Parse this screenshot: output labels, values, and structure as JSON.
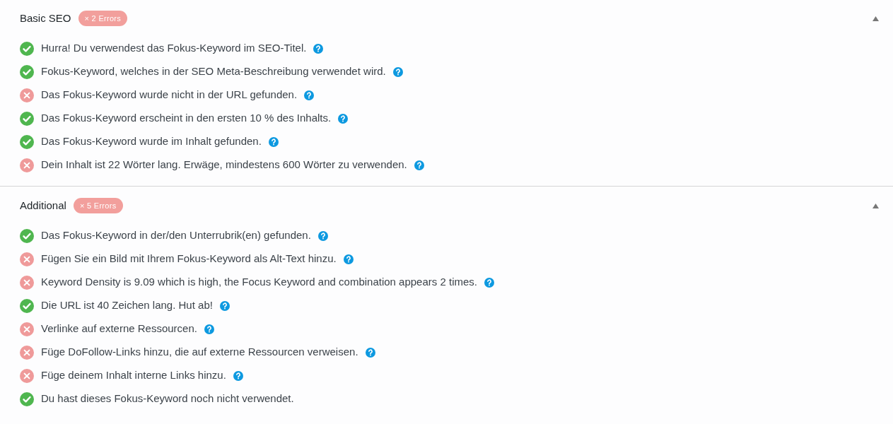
{
  "sections": [
    {
      "title": "Basic SEO",
      "badge": "× 2 Errors",
      "expanded": true,
      "items": [
        {
          "passed": true,
          "text": "Hurra! Du verwendest das Fokus-Keyword im SEO-Titel.",
          "help": true
        },
        {
          "passed": true,
          "text": "Fokus-Keyword, welches in der SEO Meta-Beschreibung verwendet wird.",
          "help": true
        },
        {
          "passed": false,
          "text": "Das Fokus-Keyword wurde nicht in der URL gefunden.",
          "help": true
        },
        {
          "passed": true,
          "text": "Das Fokus-Keyword erscheint in den ersten 10 % des Inhalts.",
          "help": true
        },
        {
          "passed": true,
          "text": "Das Fokus-Keyword wurde im Inhalt gefunden.",
          "help": true
        },
        {
          "passed": false,
          "text": "Dein Inhalt ist 22 Wörter lang. Erwäge, mindestens 600 Wörter zu verwenden.",
          "help": true
        }
      ]
    },
    {
      "title": "Additional",
      "badge": "× 5 Errors",
      "expanded": true,
      "items": [
        {
          "passed": true,
          "text": "Das Fokus-Keyword in der/den Unterrubrik(en) gefunden.",
          "help": true
        },
        {
          "passed": false,
          "text": "Fügen Sie ein Bild mit Ihrem Fokus-Keyword als Alt-Text hinzu.",
          "help": true
        },
        {
          "passed": false,
          "text": "Keyword Density is 9.09 which is high, the Focus Keyword and combination appears 2 times.",
          "help": true
        },
        {
          "passed": true,
          "text": "Die URL ist 40 Zeichen lang. Hut ab!",
          "help": true
        },
        {
          "passed": false,
          "text": "Verlinke auf externe Ressourcen.",
          "help": true
        },
        {
          "passed": false,
          "text": "Füge DoFollow-Links hinzu, die auf externe Ressourcen verweisen.",
          "help": true
        },
        {
          "passed": false,
          "text": "Füge deinem Inhalt interne Links hinzu.",
          "help": true
        },
        {
          "passed": true,
          "text": "Du hast dieses Fokus-Keyword noch nicht verwendet.",
          "help": false
        }
      ]
    }
  ]
}
